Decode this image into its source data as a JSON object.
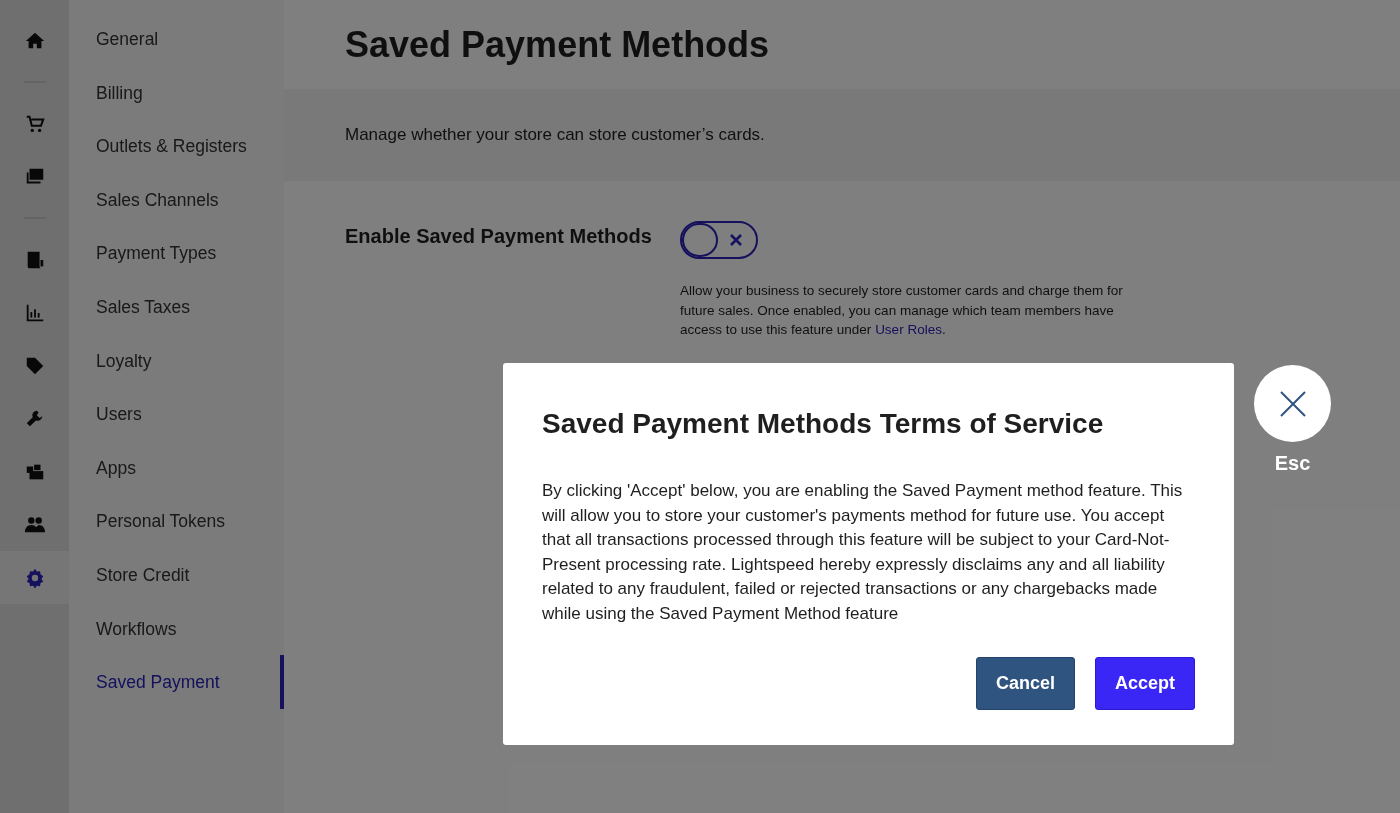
{
  "rail": {
    "groups": [
      [
        {
          "selected": false
        }
      ],
      [
        {
          "selected": false
        },
        {
          "selected": false
        }
      ],
      [
        {
          "selected": false
        },
        {
          "selected": false
        },
        {
          "selected": false
        },
        {
          "selected": false
        },
        {
          "selected": false
        },
        {
          "selected": false
        },
        {
          "selected": true
        }
      ]
    ]
  },
  "sidebar": {
    "items": [
      {
        "label": "General",
        "selected": false
      },
      {
        "label": "Billing",
        "selected": false
      },
      {
        "label": "Outlets & Registers",
        "selected": false
      },
      {
        "label": "Sales Channels",
        "selected": false
      },
      {
        "label": "Payment Types",
        "selected": false
      },
      {
        "label": "Sales Taxes",
        "selected": false
      },
      {
        "label": "Loyalty",
        "selected": false
      },
      {
        "label": "Users",
        "selected": false
      },
      {
        "label": "Apps",
        "selected": false
      },
      {
        "label": "Personal Tokens",
        "selected": false
      },
      {
        "label": "Store Credit",
        "selected": false
      },
      {
        "label": "Workflows",
        "selected": false
      },
      {
        "label": "Saved Payment",
        "selected": true
      }
    ]
  },
  "page": {
    "title": "Saved Payment Methods",
    "subtitle": "Manage whether your store can store customer’s cards.",
    "setting": {
      "label": "Enable Saved Payment Methods",
      "on": false,
      "description": "Allow your business to securely store customer cards and charge them for future sales. Once enabled, you can manage which team members have access to use this feature under",
      "link": "User Roles",
      "after_link": "."
    }
  },
  "dialog": {
    "title": "Saved Payment Methods Terms of Service",
    "body": "By clicking 'Accept' below, you are enabling the Saved Payment method feature. This will allow you to store your customer's payments method for future use. You accept that all transactions processed through this feature will be subject to your Card-Not-Present processing rate. Lightspeed hereby expressly disclaims any and all liability related to any fraudulent, failed or rejected transactions or any chargebacks made while using the Saved Payment Method feature",
    "buttons": [
      {
        "label": "Cancel",
        "kind": "secondary"
      },
      {
        "label": "Accept",
        "kind": "primary"
      }
    ],
    "close_label": "Esc"
  }
}
